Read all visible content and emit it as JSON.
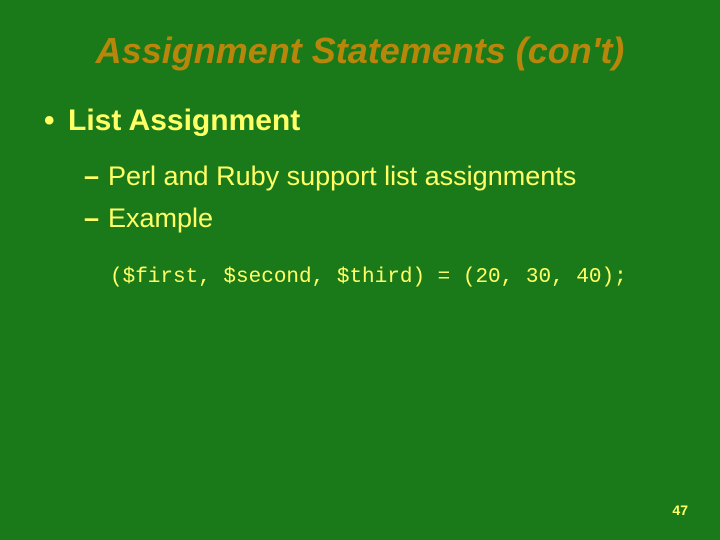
{
  "title": "Assignment Statements (con't)",
  "bullets": {
    "l1_0": "List Assignment",
    "l2_0": "Perl and Ruby support list assignments",
    "l2_1": "Example"
  },
  "code": "($first, $second, $third) = (20, 30, 40);",
  "page_number": "47"
}
